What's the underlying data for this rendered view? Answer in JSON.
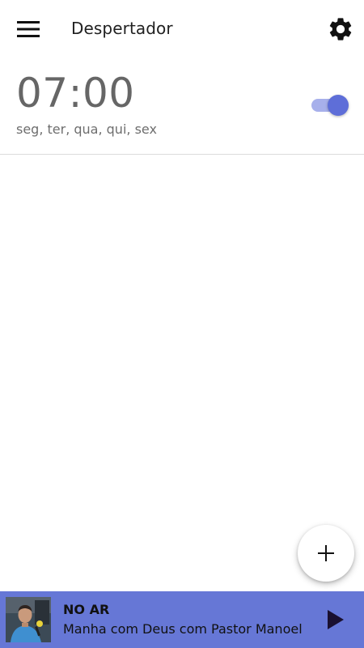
{
  "header": {
    "title": "Despertador",
    "menu_icon": "hamburger-menu-icon",
    "settings_icon": "gear-icon"
  },
  "alarm": {
    "time": "07:00",
    "days": "seg, ter, qua, qui, sex",
    "enabled": true
  },
  "fab": {
    "icon": "plus-icon"
  },
  "player": {
    "status": "NO AR",
    "program": "Manha com Deus com Pastor Manoel",
    "play_icon": "play-icon"
  },
  "colors": {
    "accent": "#5e6ed8",
    "accent_light": "#a7b0eb",
    "player_bar": "#6677d6"
  }
}
